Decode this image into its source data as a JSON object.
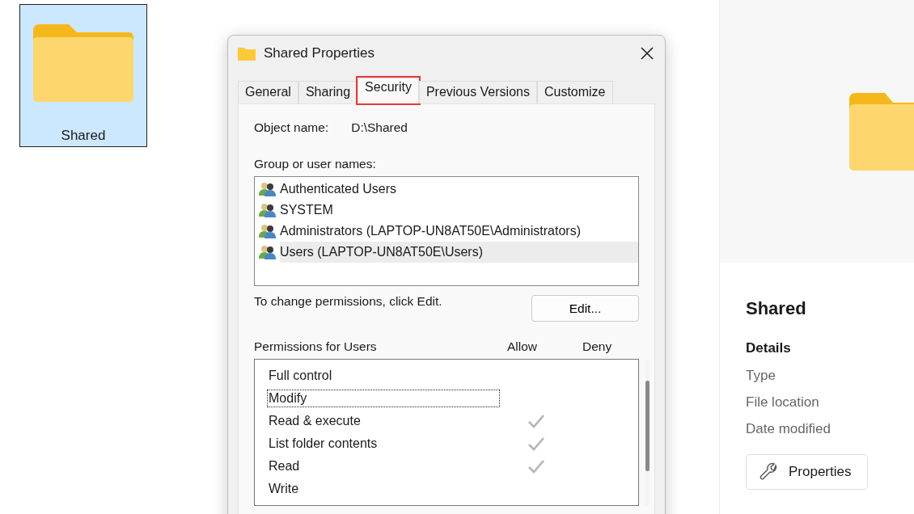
{
  "folder_item": {
    "label": "Shared",
    "selected": true
  },
  "dialog": {
    "title": "Shared Properties",
    "tabs": [
      {
        "label": "General",
        "selected": false,
        "highlighted": false
      },
      {
        "label": "Sharing",
        "selected": false,
        "highlighted": false
      },
      {
        "label": "Security",
        "selected": true,
        "highlighted": true
      },
      {
        "label": "Previous Versions",
        "selected": false,
        "highlighted": false
      },
      {
        "label": "Customize",
        "selected": false,
        "highlighted": false
      }
    ],
    "object_name_label": "Object name:",
    "object_name": "D:\\Shared",
    "group_label": "Group or user names:",
    "users": [
      {
        "name": "Authenticated Users",
        "selected": false
      },
      {
        "name": "SYSTEM",
        "selected": false
      },
      {
        "name": "Administrators (LAPTOP-UN8AT50E\\Administrators)",
        "selected": false
      },
      {
        "name": "Users (LAPTOP-UN8AT50E\\Users)",
        "selected": true
      }
    ],
    "edit_hint": "To change permissions, click Edit.",
    "edit_button": "Edit...",
    "permissions_label": "Permissions for Users",
    "allow_header": "Allow",
    "deny_header": "Deny",
    "permissions": [
      {
        "name": "Full control",
        "allow": false,
        "focused": false
      },
      {
        "name": "Modify",
        "allow": false,
        "focused": true
      },
      {
        "name": "Read & execute",
        "allow": true,
        "focused": false
      },
      {
        "name": "List folder contents",
        "allow": true,
        "focused": false
      },
      {
        "name": "Read",
        "allow": true,
        "focused": false
      },
      {
        "name": "Write",
        "allow": false,
        "focused": false
      }
    ]
  },
  "details_pane": {
    "title": "Shared",
    "details_heading": "Details",
    "fields": [
      "Type",
      "File location",
      "Date modified"
    ],
    "properties_button": "Properties"
  }
}
